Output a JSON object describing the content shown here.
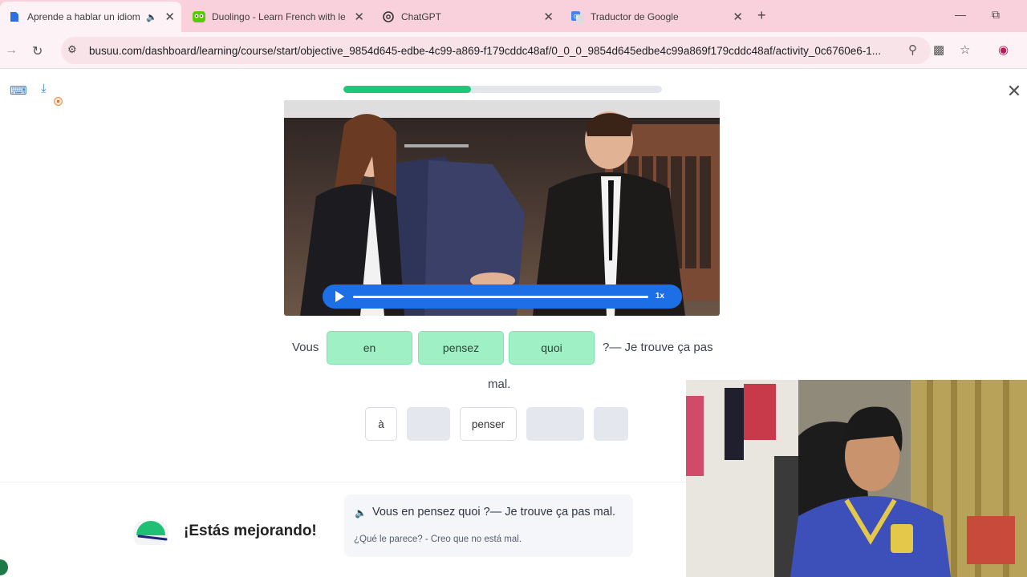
{
  "browser": {
    "tabs": [
      {
        "title": "Aprende a hablar un idioma",
        "active": true
      },
      {
        "title": "Duolingo - Learn French with le",
        "active": false
      },
      {
        "title": "ChatGPT",
        "active": false
      },
      {
        "title": "Traductor de Google",
        "active": false
      }
    ],
    "url": "busuu.com/dashboard/learning/course/start/objective_9854d645-edbe-4c99-a869-f179cddc48af/0_0_0_9854d645edbe4c99a869f179cddc48af/activity_0c6760e6-1..."
  },
  "exercise": {
    "progress_fraction": 0.4,
    "audio_speed": "1x",
    "sentence_prefix": "Vous",
    "filled_words": [
      "en",
      "pensez",
      "quoi"
    ],
    "sentence_suffix": "?— Je trouve ça pas",
    "sentence_end": "mal.",
    "options": [
      "à",
      "penser"
    ]
  },
  "feedback": {
    "encouragement": "¡Estás mejorando!",
    "answer": "Vous en pensez quoi ?— Je trouve ça pas mal.",
    "translation": "¿Qué le parece? - Creo que no está mal."
  },
  "colors": {
    "tab_bar": "#f9d1dc",
    "progress": "#1fc77a",
    "chip": "#9ff0c5",
    "player": "#1d6fe6"
  }
}
